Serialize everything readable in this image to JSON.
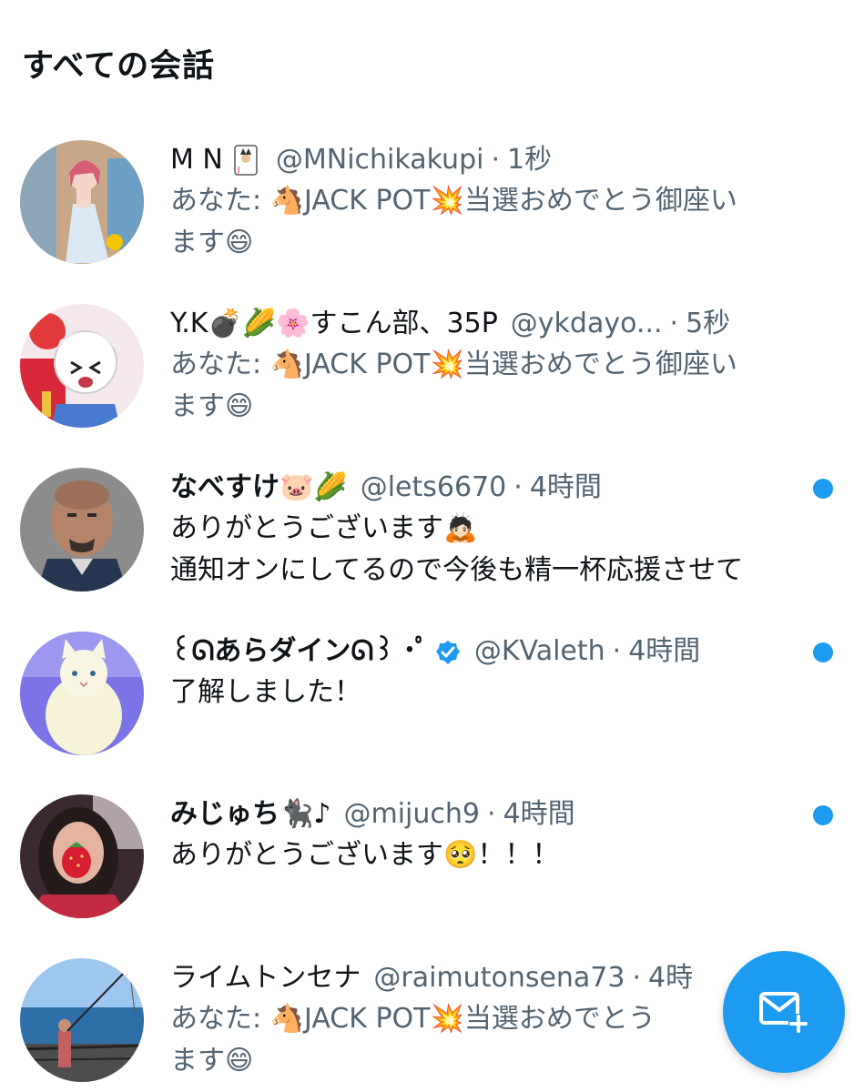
{
  "section_title": "すべての会話",
  "conversations": [
    {
      "name": "M N",
      "handle": "@MNichikakupi",
      "sep": "·",
      "time": "1秒",
      "msg_line1": "あなた: 🐴JACK POT💥当選おめでとう御座い",
      "msg_line2": "ます😄",
      "unread": false,
      "name_icon": "joker-card-icon"
    },
    {
      "name": "Y.K💣🌽🌸すこん部、35P",
      "handle": "@ykdayo...",
      "sep": "·",
      "time": "5秒",
      "msg_line1": "あなた: 🐴JACK POT💥当選おめでとう御座い",
      "msg_line2": "ます😄",
      "unread": false
    },
    {
      "name": "なべすけ🐷🌽",
      "handle": "@lets6670",
      "sep": "·",
      "time": "4時間",
      "msg_line1": "ありがとうございます🙇🏻",
      "msg_line2": "通知オンにしてるので今後も精一杯応援させて",
      "unread": true
    },
    {
      "name": "꒰ᘏあらダインᘏ꒱ ･ﾟ",
      "handle": "@KValeth",
      "sep": "·",
      "time": "4時間",
      "msg_line1": "了解しました！",
      "msg_line2": "",
      "unread": true,
      "verified": true
    },
    {
      "name": "みじゅち🐈‍⬛♪",
      "handle": "@mijuch9",
      "sep": "·",
      "time": "4時間",
      "msg_line1": "ありがとうございます🥺！！！",
      "msg_line2": "",
      "unread": true
    },
    {
      "name": "ライムトンセナ",
      "handle": "@raimutonsena73",
      "sep": "·",
      "time": "4時",
      "msg_line1": "あなた: 🐴JACK POT💥当選おめでとう",
      "msg_line2": "ます😄",
      "unread": false
    }
  ],
  "fab": {
    "icon": "new-message-icon"
  },
  "colors": {
    "accent": "#1d9bf0",
    "secondary_text": "#536471",
    "primary_text": "#0f1419"
  }
}
